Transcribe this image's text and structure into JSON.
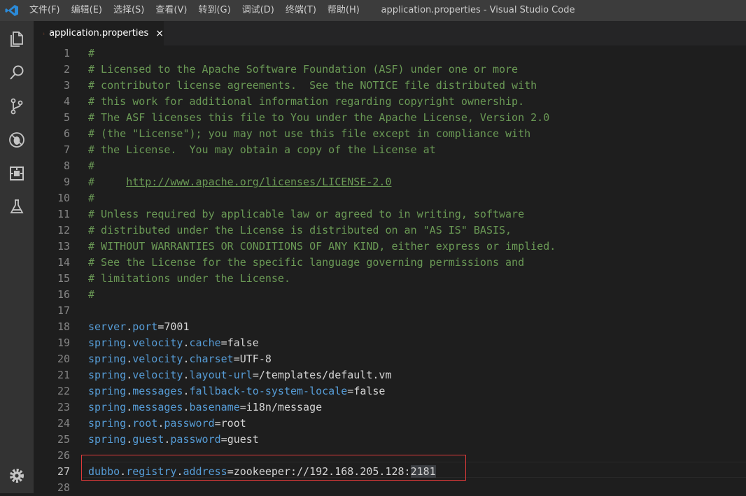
{
  "title_bar": {
    "menu": [
      "文件(F)",
      "编辑(E)",
      "选择(S)",
      "查看(V)",
      "转到(G)",
      "调试(D)",
      "终端(T)",
      "帮助(H)"
    ],
    "window_title": "application.properties - Visual Studio Code"
  },
  "activity_bar": {
    "items": [
      "explorer-icon",
      "search-icon",
      "source-control-icon",
      "debug-icon",
      "extensions-icon",
      "test-icon"
    ],
    "bottom": "gear-icon"
  },
  "tabs": [
    {
      "label": "application.properties",
      "close": "×",
      "active": true
    }
  ],
  "editor": {
    "lines": [
      {
        "n": "1",
        "t": "#"
      },
      {
        "n": "2",
        "t": "# Licensed to the Apache Software Foundation (ASF) under one or more"
      },
      {
        "n": "3",
        "t": "# contributor license agreements.  See the NOTICE file distributed with"
      },
      {
        "n": "4",
        "t": "# this work for additional information regarding copyright ownership."
      },
      {
        "n": "5",
        "t": "# The ASF licenses this file to You under the Apache License, Version 2.0"
      },
      {
        "n": "6",
        "t": "# (the \"License\"); you may not use this file except in compliance with"
      },
      {
        "n": "7",
        "t": "# the License.  You may obtain a copy of the License at"
      },
      {
        "n": "8",
        "t": "#"
      },
      {
        "n": "9",
        "t": "#     ",
        "link": "http://www.apache.org/licenses/LICENSE-2.0"
      },
      {
        "n": "10",
        "t": "#"
      },
      {
        "n": "11",
        "t": "# Unless required by applicable law or agreed to in writing, software"
      },
      {
        "n": "12",
        "t": "# distributed under the License is distributed on an \"AS IS\" BASIS,"
      },
      {
        "n": "13",
        "t": "# WITHOUT WARRANTIES OR CONDITIONS OF ANY KIND, either express or implied."
      },
      {
        "n": "14",
        "t": "# See the License for the specific language governing permissions and"
      },
      {
        "n": "15",
        "t": "# limitations under the License."
      },
      {
        "n": "16",
        "t": "#"
      },
      {
        "n": "17",
        "t": ""
      },
      {
        "n": "18",
        "key": "server.port",
        "val": "7001"
      },
      {
        "n": "19",
        "key": "spring.velocity.cache",
        "val": "false"
      },
      {
        "n": "20",
        "key": "spring.velocity.charset",
        "val": "UTF-8"
      },
      {
        "n": "21",
        "key": "spring.velocity.layout-url",
        "val": "/templates/default.vm"
      },
      {
        "n": "22",
        "key": "spring.messages.fallback-to-system-locale",
        "val": "false"
      },
      {
        "n": "23",
        "key": "spring.messages.basename",
        "val": "i18n/message"
      },
      {
        "n": "24",
        "key": "spring.root.password",
        "val": "root"
      },
      {
        "n": "25",
        "key": "spring.guest.password",
        "val": "guest"
      },
      {
        "n": "26",
        "t": ""
      },
      {
        "n": "27",
        "key": "dubbo.registry.address",
        "val": "zookeeper://192.168.205.128:",
        "sel": "2181",
        "active": true
      },
      {
        "n": "28",
        "t": ""
      }
    ]
  },
  "colors": {
    "comment": "#6a9955",
    "key": "#569cd6",
    "highlight_box": "#e03a3a"
  }
}
